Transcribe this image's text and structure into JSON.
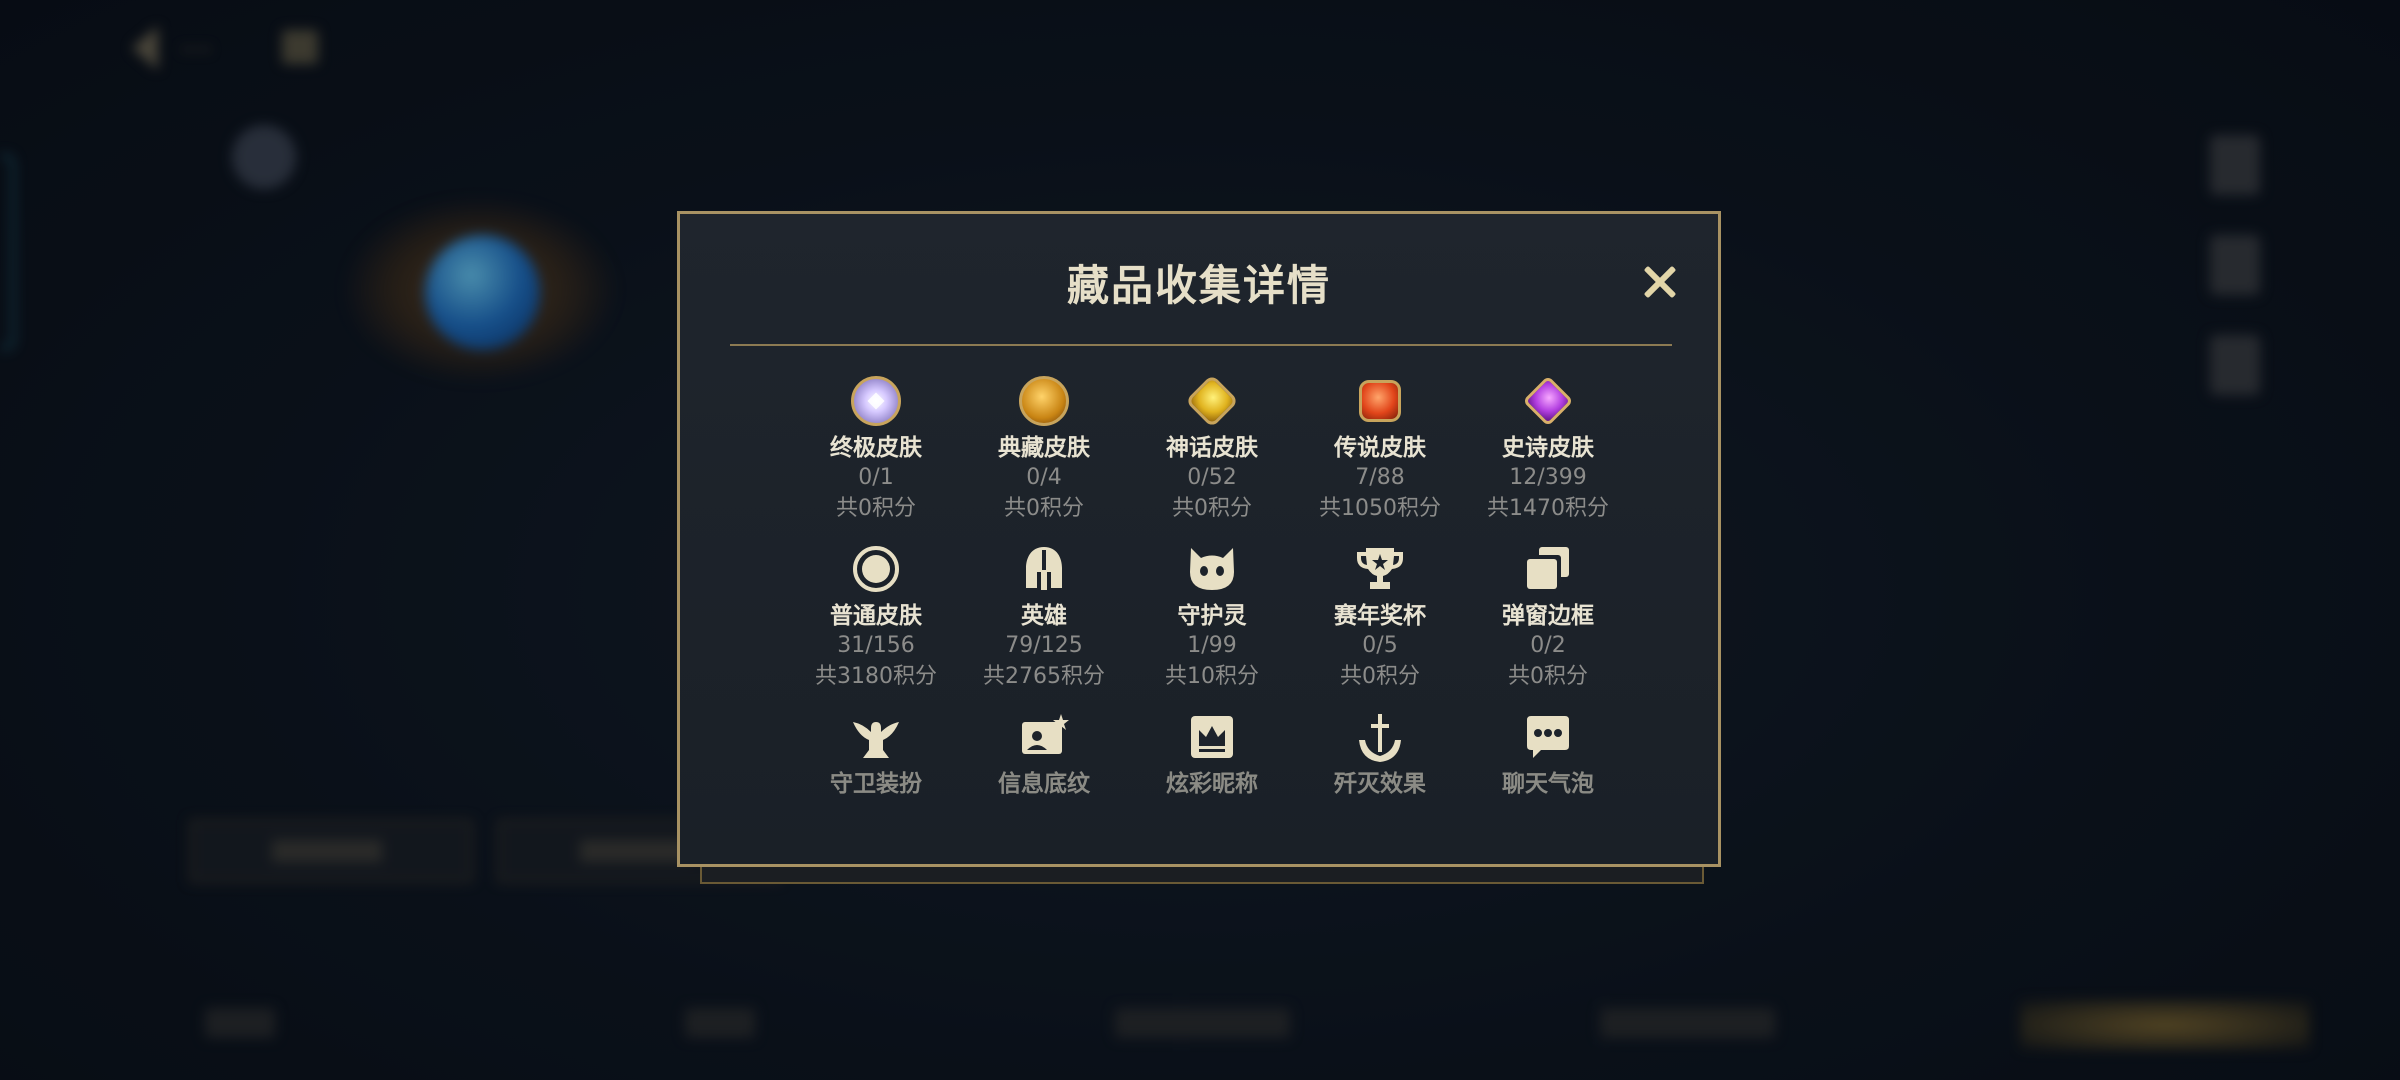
{
  "modal": {
    "title": "藏品收集详情",
    "close_glyph": ""
  },
  "items": [
    {
      "icon": "ultimate-gem-icon",
      "label": "终极皮肤",
      "count": "0/1",
      "points": "共0积分"
    },
    {
      "icon": "collection-dragon-icon",
      "label": "典藏皮肤",
      "count": "0/4",
      "points": "共0积分"
    },
    {
      "icon": "myth-gem-icon",
      "label": "神话皮肤",
      "count": "0/52",
      "points": "共0积分"
    },
    {
      "icon": "legend-gem-icon",
      "label": "传说皮肤",
      "count": "7/88",
      "points": "共1050积分"
    },
    {
      "icon": "epic-gem-icon",
      "label": "史诗皮肤",
      "count": "12/399",
      "points": "共1470积分"
    },
    {
      "icon": "ring-icon",
      "label": "普通皮肤",
      "count": "31/156",
      "points": "共3180积分"
    },
    {
      "icon": "helmet-icon",
      "label": "英雄",
      "count": "79/125",
      "points": "共2765积分"
    },
    {
      "icon": "spirit-face-icon",
      "label": "守护灵",
      "count": "1/99",
      "points": "共10积分"
    },
    {
      "icon": "trophy-icon",
      "label": "赛年奖杯",
      "count": "0/5",
      "points": "共0积分"
    },
    {
      "icon": "stacked-frames-icon",
      "label": "弹窗边框",
      "count": "0/2",
      "points": "共0积分"
    },
    {
      "icon": "guardian-statue-icon",
      "label": "守卫装扮"
    },
    {
      "icon": "info-card-icon",
      "label": "信息底纹"
    },
    {
      "icon": "crown-card-icon",
      "label": "炫彩昵称"
    },
    {
      "icon": "anchor-sword-icon",
      "label": "歼灭效果"
    },
    {
      "icon": "chat-bubble-icon",
      "label": "聊天气泡"
    }
  ]
}
